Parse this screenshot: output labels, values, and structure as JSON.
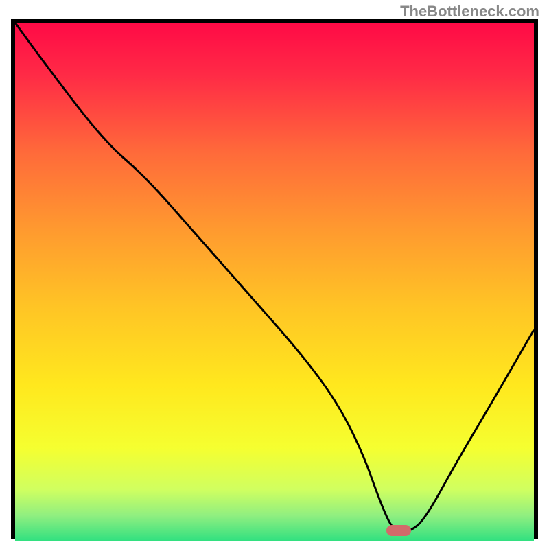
{
  "watermark": "TheBottleneck.com",
  "chart_data": {
    "type": "line",
    "title": "",
    "xlabel": "",
    "ylabel": "",
    "xlim": [
      0,
      100
    ],
    "ylim": [
      0,
      100
    ],
    "x": [
      0,
      5,
      17,
      25,
      35,
      45,
      55,
      62,
      67,
      70.5,
      73,
      76,
      79,
      85,
      92,
      100
    ],
    "values": [
      100,
      93,
      77,
      70,
      58.5,
      47,
      35.5,
      26,
      16,
      6,
      0.5,
      0.5,
      3,
      14,
      26,
      40
    ],
    "curve_note": "V-shaped curve: descending from top-left, slight slope change near x≈18, minimum flat region around x≈72-76 near y=0, rising to y≈40 at right edge",
    "marker": {
      "x_pct": 74,
      "y_pct": 99.2
    },
    "background": {
      "type": "vertical_gradient",
      "stops_top_to_bottom": [
        {
          "pos": 0.0,
          "color": "#ff0a46"
        },
        {
          "pos": 0.1,
          "color": "#ff2a46"
        },
        {
          "pos": 0.25,
          "color": "#ff6a3a"
        },
        {
          "pos": 0.4,
          "color": "#ff9a2f"
        },
        {
          "pos": 0.55,
          "color": "#ffc525"
        },
        {
          "pos": 0.7,
          "color": "#ffe81e"
        },
        {
          "pos": 0.82,
          "color": "#f5ff30"
        },
        {
          "pos": 0.9,
          "color": "#d0ff60"
        },
        {
          "pos": 0.95,
          "color": "#90ef80"
        },
        {
          "pos": 1.0,
          "color": "#2fe080"
        }
      ]
    }
  }
}
